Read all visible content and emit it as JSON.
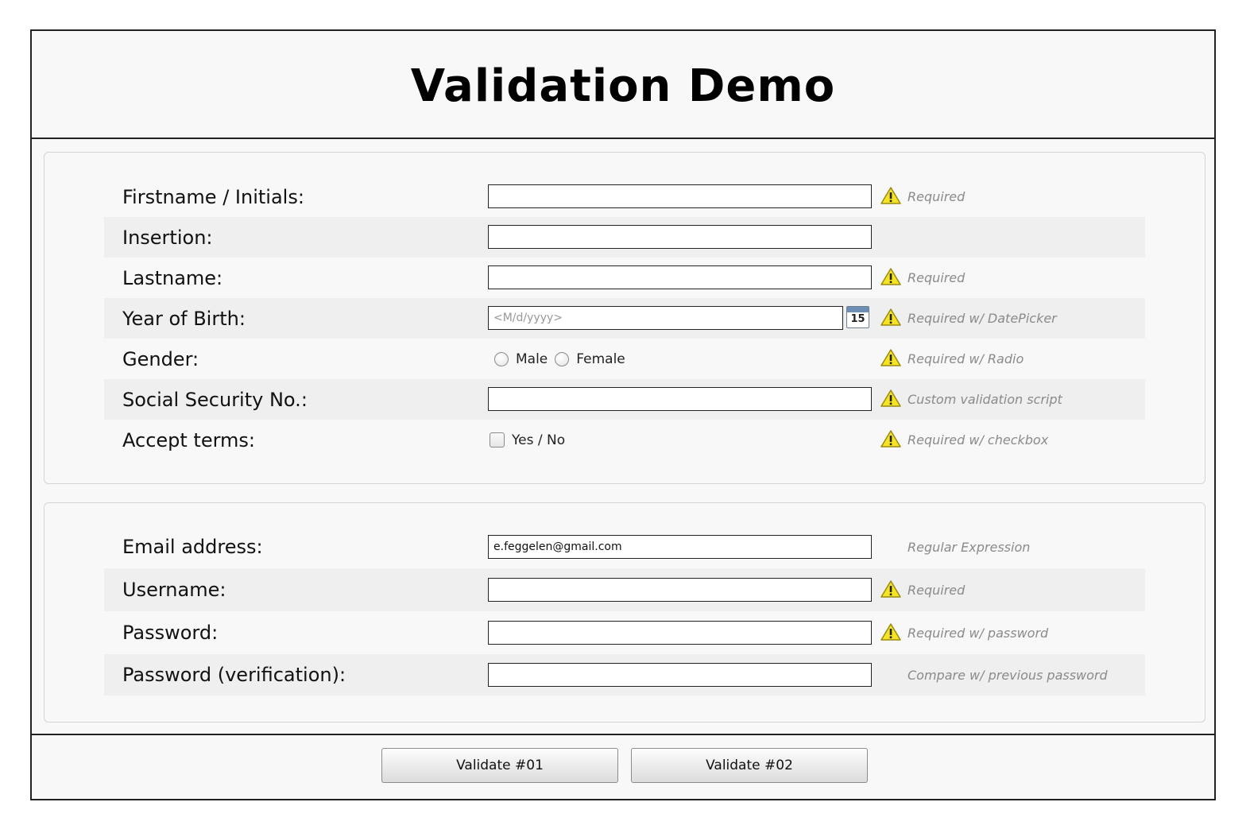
{
  "title": "Validation Demo",
  "personal": [
    {
      "label": "Firstname / Initials:",
      "type": "text",
      "value": "",
      "hint": "Required",
      "warning": true
    },
    {
      "label": "Insertion:",
      "type": "text",
      "value": "",
      "hint": "",
      "warning": false
    },
    {
      "label": "Lastname:",
      "type": "text",
      "value": "",
      "hint": "Required",
      "warning": true
    },
    {
      "label": "Year of Birth:",
      "type": "date",
      "placeholder": "<M/d/yyyy>",
      "calendar_day": "15",
      "hint": "Required w/ DatePicker",
      "warning": true
    },
    {
      "label": "Gender:",
      "type": "radio",
      "options": [
        "Male",
        "Female"
      ],
      "hint": "Required w/ Radio",
      "warning": true
    },
    {
      "label": "Social Security No.:",
      "type": "text",
      "value": "",
      "hint": "Custom validation script",
      "warning": true
    },
    {
      "label": "Accept terms:",
      "type": "checkbox",
      "checkbox_label": "Yes / No",
      "checked": false,
      "hint": "Required w/ checkbox",
      "warning": true
    }
  ],
  "account": [
    {
      "label": "Email address:",
      "type": "text",
      "value": "e.feggelen@gmail.com",
      "hint": "Regular Expression",
      "warning": false
    },
    {
      "label": "Username:",
      "type": "text",
      "value": "",
      "hint": "Required",
      "warning": true
    },
    {
      "label": "Password:",
      "type": "password",
      "value": "",
      "hint": "Required w/ password",
      "warning": true
    },
    {
      "label": "Password (verification):",
      "type": "password",
      "value": "",
      "hint": "Compare w/ previous password",
      "warning": false
    }
  ],
  "buttons": {
    "validate1": "Validate #01",
    "validate2": "Validate #02"
  },
  "colors": {
    "warning_fill": "#f5e325",
    "warning_border": "#9a8a10",
    "hint": "#8a8a8a",
    "row_alt": "#efefef"
  },
  "icons": {
    "warning": "warning-icon",
    "calendar": "calendar-icon"
  }
}
